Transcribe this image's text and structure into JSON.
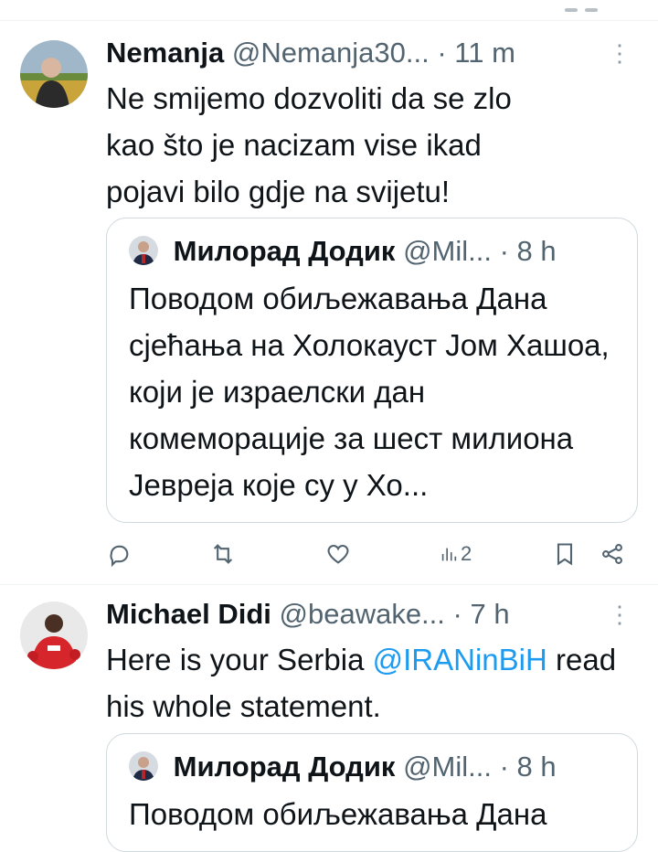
{
  "tweets": [
    {
      "name": "Nemanja",
      "handle": "@Nemanja30...",
      "sep": "·",
      "time": "11 m",
      "text": "Ne smijemo dozvoliti da se zlo kao što je nacizam vise ikad pojavi bilo gdje na svijetu!",
      "quote": {
        "name": "Милорад Додик",
        "handle": "@Mil...",
        "sep": "·",
        "time": "8 h",
        "text": "Поводом обиљежавања Дана сјећања на Холокауст Јом Хашоа, који је израелски дан комеморације за шест милиона Јевреја које су у Хо..."
      },
      "actions": {
        "views": "2"
      }
    },
    {
      "name": "Michael Didi",
      "handle": "@beawake...",
      "sep": "·",
      "time": "7 h",
      "text_prefix": "Here is your Serbia ",
      "mention": "@IRANinBiH",
      "text_suffix": " read his whole statement.",
      "quote": {
        "name": "Милорад Додик",
        "handle": "@Mil...",
        "sep": "·",
        "time": "8 h",
        "text": "Поводом обиљежавања Дана"
      }
    }
  ],
  "icons": {
    "reply": "comment-icon",
    "retweet": "retweet-icon",
    "like": "heart-icon",
    "views": "views-chart-icon",
    "bookmark": "bookmark-icon",
    "share": "share-icon",
    "more": "more-dots-icon"
  },
  "colors": {
    "link": "#1d9bf0",
    "muted": "#536471",
    "border": "#cfd9de"
  }
}
